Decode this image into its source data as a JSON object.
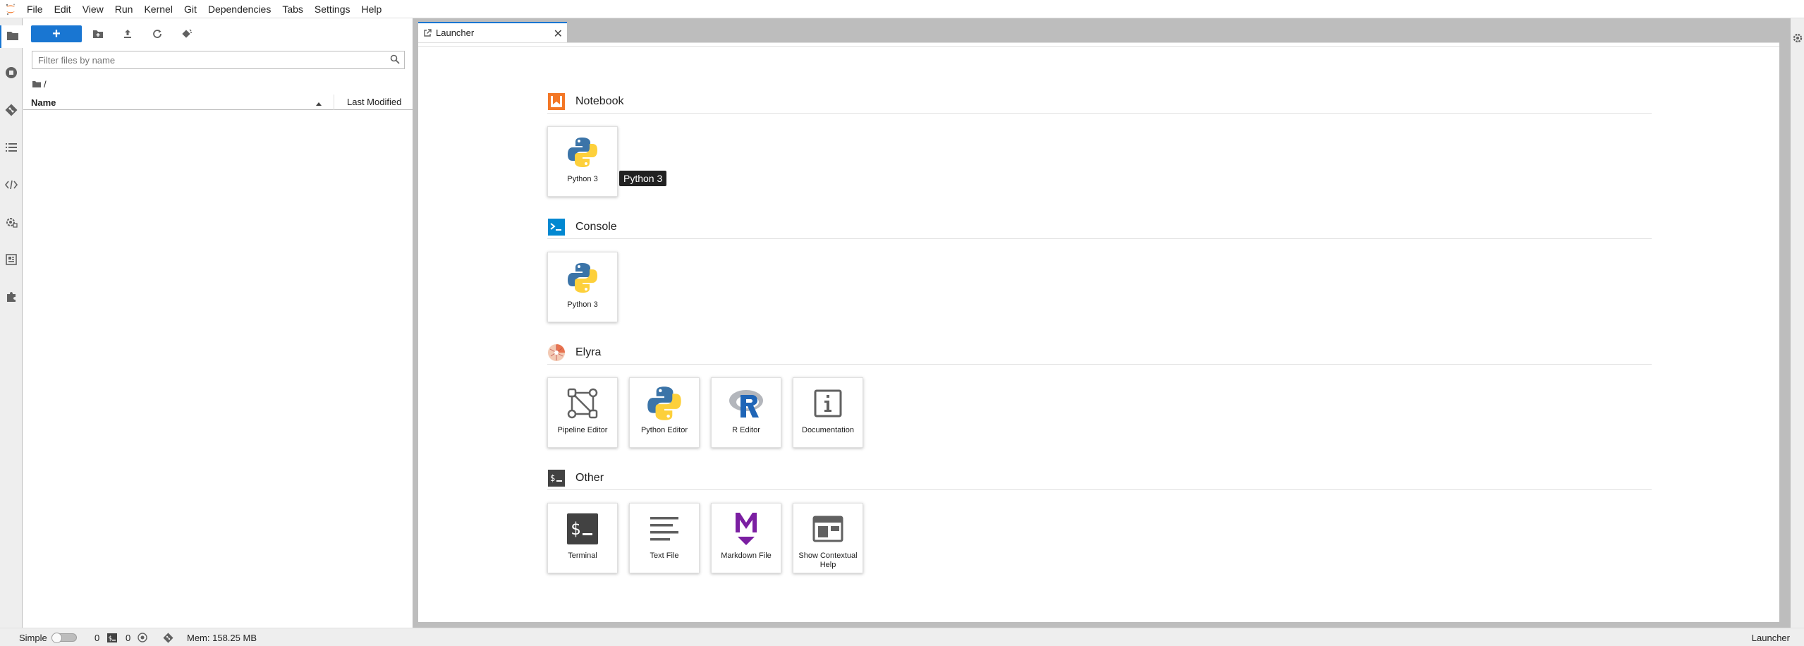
{
  "menubar": {
    "items": [
      "File",
      "Edit",
      "View",
      "Run",
      "Kernel",
      "Git",
      "Dependencies",
      "Tabs",
      "Settings",
      "Help"
    ]
  },
  "filebrowser": {
    "new_label": "+",
    "filter_placeholder": "Filter files by name",
    "breadcrumb": "/",
    "columns": {
      "name": "Name",
      "modified": "Last Modified"
    }
  },
  "dock": {
    "tab": {
      "label": "Launcher",
      "close": "✕"
    }
  },
  "launcher": {
    "sections": [
      {
        "title": "Notebook",
        "cards": [
          {
            "label": "Python 3",
            "icon": "python-icon"
          }
        ]
      },
      {
        "title": "Console",
        "cards": [
          {
            "label": "Python 3",
            "icon": "python-icon"
          }
        ]
      },
      {
        "title": "Elyra",
        "cards": [
          {
            "label": "Pipeline Editor",
            "icon": "pipeline-icon"
          },
          {
            "label": "Python Editor",
            "icon": "python-icon"
          },
          {
            "label": "R Editor",
            "icon": "r-icon"
          },
          {
            "label": "Documentation",
            "icon": "info-icon"
          }
        ]
      },
      {
        "title": "Other",
        "cards": [
          {
            "label": "Terminal",
            "icon": "terminal-icon"
          },
          {
            "label": "Text File",
            "icon": "text-file-icon"
          },
          {
            "label": "Markdown File",
            "icon": "markdown-icon"
          },
          {
            "label": "Show Contextual Help",
            "icon": "contextual-help-icon"
          }
        ]
      }
    ],
    "tooltip": "Python 3"
  },
  "statusbar": {
    "mode_label": "Simple",
    "mode_enabled": false,
    "kernels_count": "0",
    "terminals_count": "0",
    "memory": "Mem: 158.25 MB",
    "active_tab": "Launcher"
  },
  "colors": {
    "accent": "#1976d2",
    "notebook_orange": "#f37726",
    "console_blue": "#0288d1",
    "markdown_purple": "#7b1fa2"
  }
}
